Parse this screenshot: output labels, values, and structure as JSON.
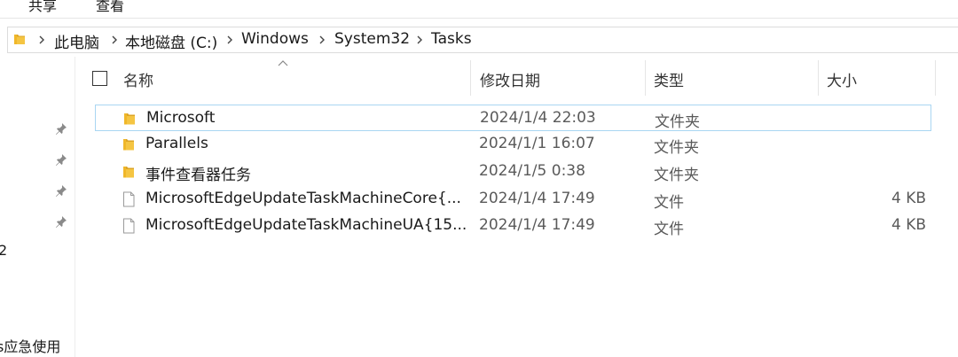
{
  "ribbon": {
    "tabs": [
      "共享",
      "查看"
    ]
  },
  "address_bar": {
    "crumbs": [
      "此电脑",
      "本地磁盘 (C:)",
      "Windows",
      "System32",
      "Tasks"
    ]
  },
  "nav": {
    "partial_items": [
      "2",
      "s应急使用"
    ]
  },
  "columns": {
    "name": "名称",
    "modified": "修改日期",
    "type": "类型",
    "size": "大小"
  },
  "files": [
    {
      "icon": "folder-icon",
      "name": "Microsoft",
      "modified": "2024/1/4 22:03",
      "type": "文件夹",
      "size": "",
      "selected": true
    },
    {
      "icon": "folder-icon",
      "name": "Parallels",
      "modified": "2024/1/1 16:07",
      "type": "文件夹",
      "size": "",
      "selected": false
    },
    {
      "icon": "folder-icon",
      "name": "事件查看器任务",
      "modified": "2024/1/5 0:38",
      "type": "文件夹",
      "size": "",
      "selected": false
    },
    {
      "icon": "file-icon",
      "name": "MicrosoftEdgeUpdateTaskMachineCore{...",
      "modified": "2024/1/4 17:49",
      "type": "文件",
      "size": "4 KB",
      "selected": false
    },
    {
      "icon": "file-icon",
      "name": "MicrosoftEdgeUpdateTaskMachineUA{15...",
      "modified": "2024/1/4 17:49",
      "type": "文件",
      "size": "4 KB",
      "selected": false
    }
  ],
  "colors": {
    "selection_border": "#a9d6f2",
    "folder_yellow": "#f5c542",
    "folder_dark": "#dca426"
  }
}
